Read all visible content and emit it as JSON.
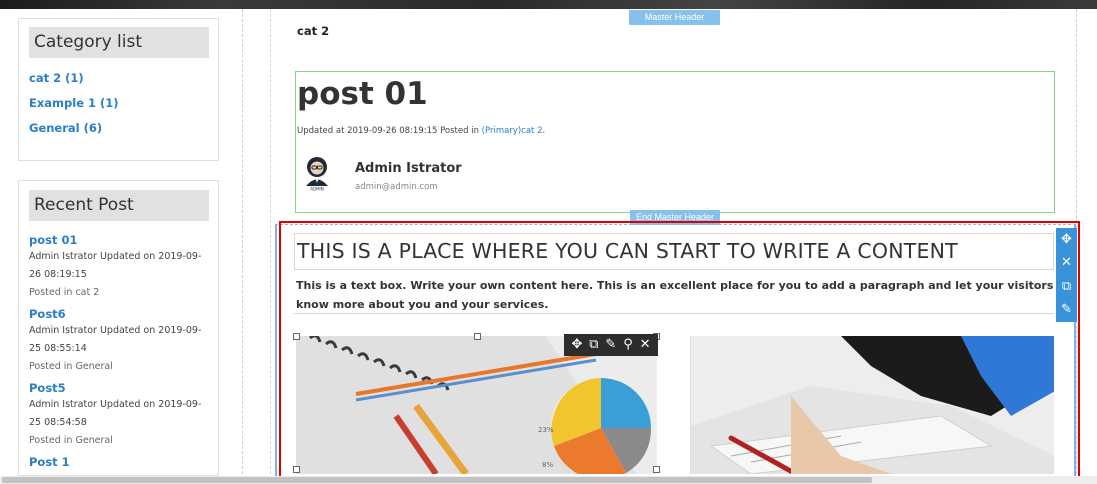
{
  "sidebar": {
    "category_title": "Category list",
    "categories": [
      {
        "label": "cat 2 (1)"
      },
      {
        "label": "Example 1 (1)"
      },
      {
        "label": "General (6)"
      }
    ],
    "recent_title": "Recent Post",
    "recent_posts": [
      {
        "title": "post 01",
        "meta": "Admin Istrator Updated on 2019-09-26 08:19:15",
        "category": "Posted in cat 2"
      },
      {
        "title": "Post6",
        "meta": "Admin Istrator Updated on 2019-09-25 08:55:14",
        "category": "Posted in General"
      },
      {
        "title": "Post5",
        "meta": "Admin Istrator Updated on 2019-09-25 08:54:58",
        "category": "Posted in General"
      },
      {
        "title": "Post 1"
      }
    ]
  },
  "header": {
    "category_label": "cat 2",
    "master_header_badge": "Master Header",
    "end_master_header_badge": "End Master Header"
  },
  "post": {
    "title": "post 01",
    "meta_prefix": "Updated at 2019-09-26 08:19:15 Posted in ",
    "meta_link": "(Primary)cat 2",
    "meta_suffix": ".",
    "author_name": "Admin Istrator",
    "author_email": "admin@admin.com",
    "avatar_text": "ADMIN"
  },
  "content": {
    "heading": "THIS IS A PLACE WHERE YOU CAN START TO WRITE A CONTENT",
    "paragraph": "This is a text box. Write your own content here. This is an excellent place for you to add a paragraph and let your visitors know more about you and your services.",
    "pie_labels": [
      "23%",
      "8%"
    ]
  },
  "toolbars": {
    "image_tools": [
      {
        "icon": "move-icon",
        "glyph": "✥"
      },
      {
        "icon": "duplicate-icon",
        "glyph": "⧉"
      },
      {
        "icon": "edit-icon",
        "glyph": "✎"
      },
      {
        "icon": "pin-icon",
        "glyph": "⚲"
      },
      {
        "icon": "close-icon",
        "glyph": "✕"
      }
    ],
    "section_tools": [
      {
        "icon": "move-icon",
        "glyph": "✥"
      },
      {
        "icon": "close-icon",
        "glyph": "✕"
      },
      {
        "icon": "duplicate-icon",
        "glyph": "⧉"
      },
      {
        "icon": "edit-icon",
        "glyph": "✎"
      }
    ]
  },
  "colors": {
    "link": "#2a7ec7",
    "badge": "#85c1ec",
    "selection": "#e00000",
    "master_border": "#83d38f",
    "edit_toolbar": "#3a93d8"
  }
}
